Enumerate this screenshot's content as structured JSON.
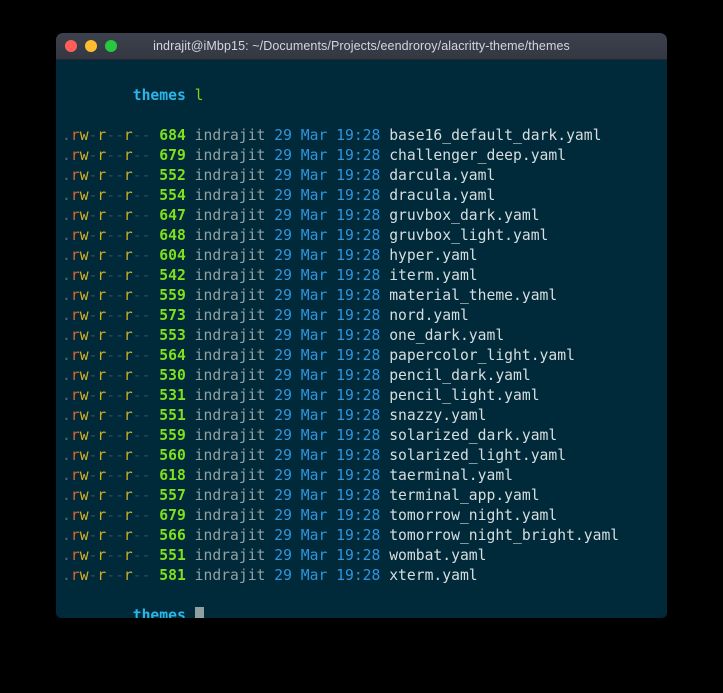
{
  "window": {
    "title": "indrajit@iMbp15: ~/Documents/Projects/eendroroy/alacritty-theme/themes",
    "traffic_lights": [
      {
        "name": "close",
        "color": "#ff5f57"
      },
      {
        "name": "minimize",
        "color": "#febc2e"
      },
      {
        "name": "maximize",
        "color": "#28c840"
      }
    ]
  },
  "colors": {
    "desktop_bg": "#000000",
    "titlebar_bg": "#363b47",
    "terminal_bg": "#00293a",
    "prompt": "#2bb6e8",
    "command": "#7fd41b",
    "size": "#7fe01c",
    "user": "#93a1a1",
    "date": "#2f95dd",
    "filename": "#d6dedf",
    "perm_read": "#e8642a",
    "perm_write": "#d9b228",
    "perm_dash": "#2d4f5c",
    "cursor": "#8fa0a3"
  },
  "terminal": {
    "prompt_label": "themes",
    "command": "l",
    "permissions": {
      "leading_dot": ".",
      "tokens": [
        {
          "t": "r",
          "k": "r"
        },
        {
          "t": "w",
          "k": "w"
        },
        {
          "t": "-",
          "k": "d"
        },
        {
          "t": "r",
          "k": "r2"
        },
        {
          "t": "-",
          "k": "d"
        },
        {
          "t": "-",
          "k": "d"
        },
        {
          "t": "r",
          "k": "r2"
        },
        {
          "t": "-",
          "k": "d"
        },
        {
          "t": "-",
          "k": "d"
        }
      ],
      "text": ".rw-r--r--"
    },
    "owner": "indrajit",
    "date": "29 Mar",
    "time": "19:28",
    "files": [
      {
        "perms": ".rw-r--r--",
        "size": "684",
        "owner": "indrajit",
        "date": "29 Mar",
        "time": "19:28",
        "name": "base16_default_dark.yaml"
      },
      {
        "perms": ".rw-r--r--",
        "size": "679",
        "owner": "indrajit",
        "date": "29 Mar",
        "time": "19:28",
        "name": "challenger_deep.yaml"
      },
      {
        "perms": ".rw-r--r--",
        "size": "552",
        "owner": "indrajit",
        "date": "29 Mar",
        "time": "19:28",
        "name": "darcula.yaml"
      },
      {
        "perms": ".rw-r--r--",
        "size": "554",
        "owner": "indrajit",
        "date": "29 Mar",
        "time": "19:28",
        "name": "dracula.yaml"
      },
      {
        "perms": ".rw-r--r--",
        "size": "647",
        "owner": "indrajit",
        "date": "29 Mar",
        "time": "19:28",
        "name": "gruvbox_dark.yaml"
      },
      {
        "perms": ".rw-r--r--",
        "size": "648",
        "owner": "indrajit",
        "date": "29 Mar",
        "time": "19:28",
        "name": "gruvbox_light.yaml"
      },
      {
        "perms": ".rw-r--r--",
        "size": "604",
        "owner": "indrajit",
        "date": "29 Mar",
        "time": "19:28",
        "name": "hyper.yaml"
      },
      {
        "perms": ".rw-r--r--",
        "size": "542",
        "owner": "indrajit",
        "date": "29 Mar",
        "time": "19:28",
        "name": "iterm.yaml"
      },
      {
        "perms": ".rw-r--r--",
        "size": "559",
        "owner": "indrajit",
        "date": "29 Mar",
        "time": "19:28",
        "name": "material_theme.yaml"
      },
      {
        "perms": ".rw-r--r--",
        "size": "573",
        "owner": "indrajit",
        "date": "29 Mar",
        "time": "19:28",
        "name": "nord.yaml"
      },
      {
        "perms": ".rw-r--r--",
        "size": "553",
        "owner": "indrajit",
        "date": "29 Mar",
        "time": "19:28",
        "name": "one_dark.yaml"
      },
      {
        "perms": ".rw-r--r--",
        "size": "564",
        "owner": "indrajit",
        "date": "29 Mar",
        "time": "19:28",
        "name": "papercolor_light.yaml"
      },
      {
        "perms": ".rw-r--r--",
        "size": "530",
        "owner": "indrajit",
        "date": "29 Mar",
        "time": "19:28",
        "name": "pencil_dark.yaml"
      },
      {
        "perms": ".rw-r--r--",
        "size": "531",
        "owner": "indrajit",
        "date": "29 Mar",
        "time": "19:28",
        "name": "pencil_light.yaml"
      },
      {
        "perms": ".rw-r--r--",
        "size": "551",
        "owner": "indrajit",
        "date": "29 Mar",
        "time": "19:28",
        "name": "snazzy.yaml"
      },
      {
        "perms": ".rw-r--r--",
        "size": "559",
        "owner": "indrajit",
        "date": "29 Mar",
        "time": "19:28",
        "name": "solarized_dark.yaml"
      },
      {
        "perms": ".rw-r--r--",
        "size": "560",
        "owner": "indrajit",
        "date": "29 Mar",
        "time": "19:28",
        "name": "solarized_light.yaml"
      },
      {
        "perms": ".rw-r--r--",
        "size": "618",
        "owner": "indrajit",
        "date": "29 Mar",
        "time": "19:28",
        "name": "taerminal.yaml"
      },
      {
        "perms": ".rw-r--r--",
        "size": "557",
        "owner": "indrajit",
        "date": "29 Mar",
        "time": "19:28",
        "name": "terminal_app.yaml"
      },
      {
        "perms": ".rw-r--r--",
        "size": "679",
        "owner": "indrajit",
        "date": "29 Mar",
        "time": "19:28",
        "name": "tomorrow_night.yaml"
      },
      {
        "perms": ".rw-r--r--",
        "size": "566",
        "owner": "indrajit",
        "date": "29 Mar",
        "time": "19:28",
        "name": "tomorrow_night_bright.yaml"
      },
      {
        "perms": ".rw-r--r--",
        "size": "551",
        "owner": "indrajit",
        "date": "29 Mar",
        "time": "19:28",
        "name": "wombat.yaml"
      },
      {
        "perms": ".rw-r--r--",
        "size": "581",
        "owner": "indrajit",
        "date": "29 Mar",
        "time": "19:28",
        "name": "xterm.yaml"
      }
    ]
  }
}
